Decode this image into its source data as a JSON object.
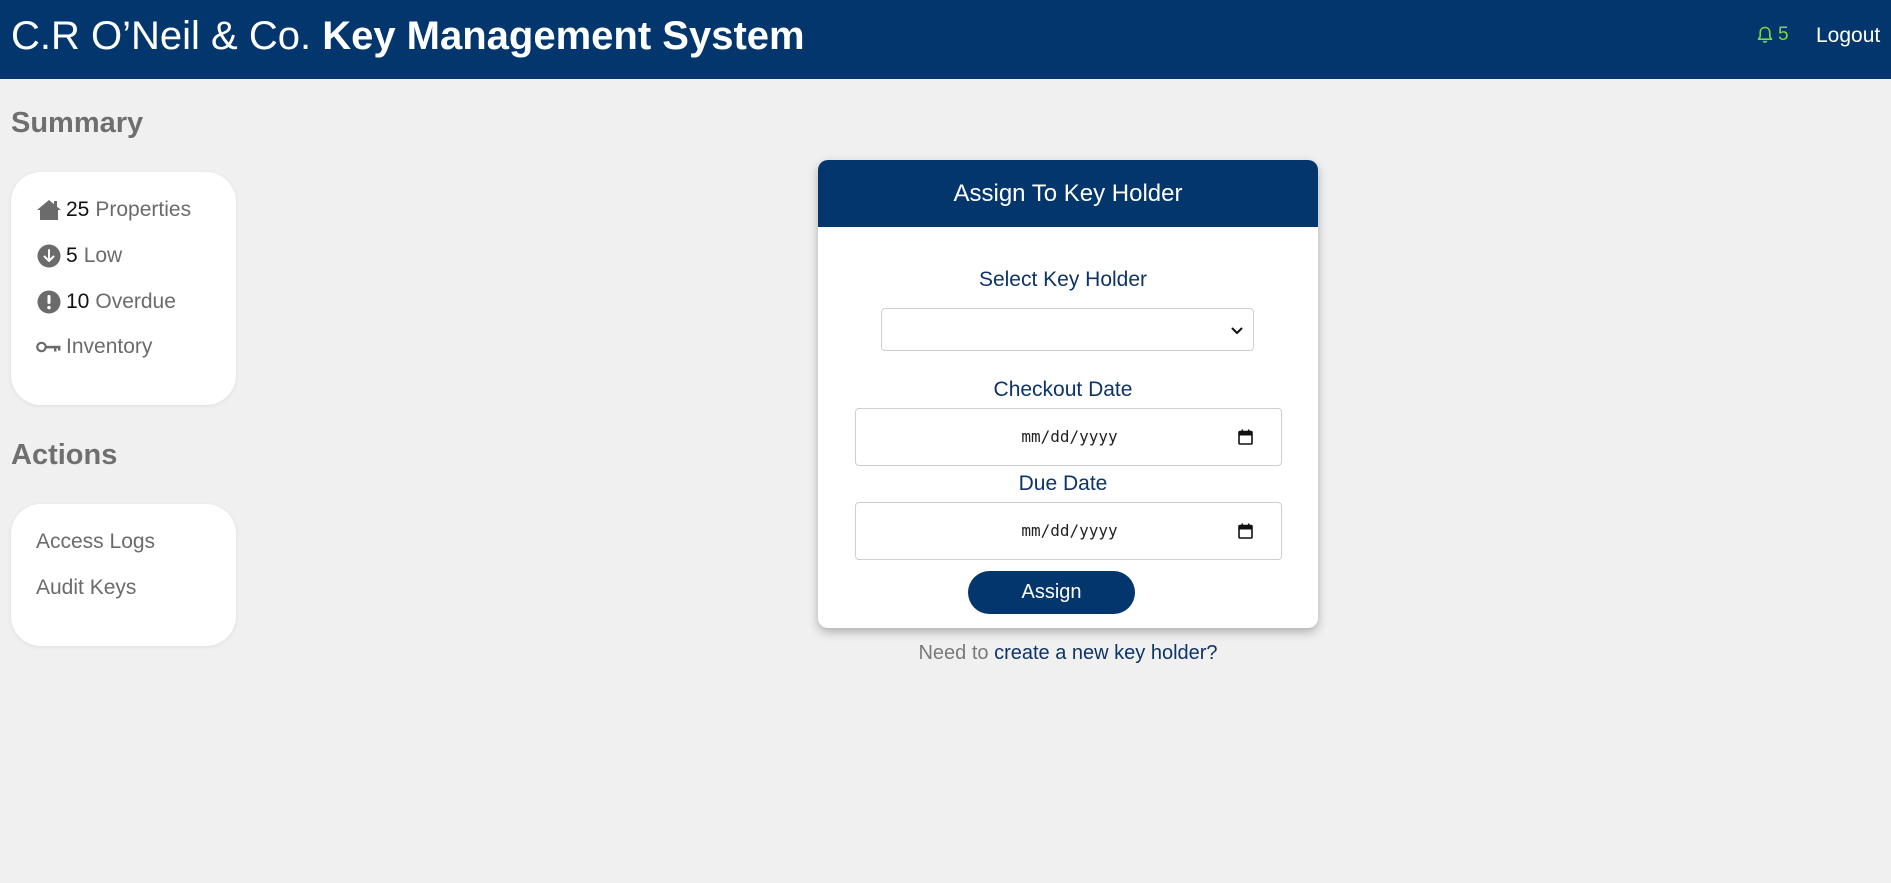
{
  "header": {
    "company": "C.R O’Neil & Co.",
    "app_name": "Key Management System",
    "notification_count": "5",
    "logout_label": "Logout",
    "colors": {
      "bar": "#02366c",
      "notification": "#7cdb3c"
    }
  },
  "sidebar": {
    "summary_heading": "Summary",
    "summary_items": [
      {
        "icon": "house-icon",
        "count": "25",
        "label": "Properties"
      },
      {
        "icon": "arrow-down-circle-icon",
        "count": "5",
        "label": "Low"
      },
      {
        "icon": "exclamation-circle-icon",
        "count": "10",
        "label": "Overdue"
      },
      {
        "icon": "key-icon",
        "count": "",
        "label": "Inventory"
      }
    ],
    "actions_heading": "Actions",
    "actions": [
      {
        "label": "Access Logs"
      },
      {
        "label": "Audit Keys"
      }
    ]
  },
  "form": {
    "title": "Assign To Key Holder",
    "key_holder_label": "Select Key Holder",
    "key_holder_value": "",
    "checkout_label": "Checkout Date",
    "checkout_placeholder": "mm/dd/yyyy",
    "due_label": "Due Date",
    "due_placeholder": "mm/dd/yyyy",
    "submit_label": "Assign"
  },
  "footer": {
    "prefix": "Need to",
    "link": "create a new key holder?"
  }
}
